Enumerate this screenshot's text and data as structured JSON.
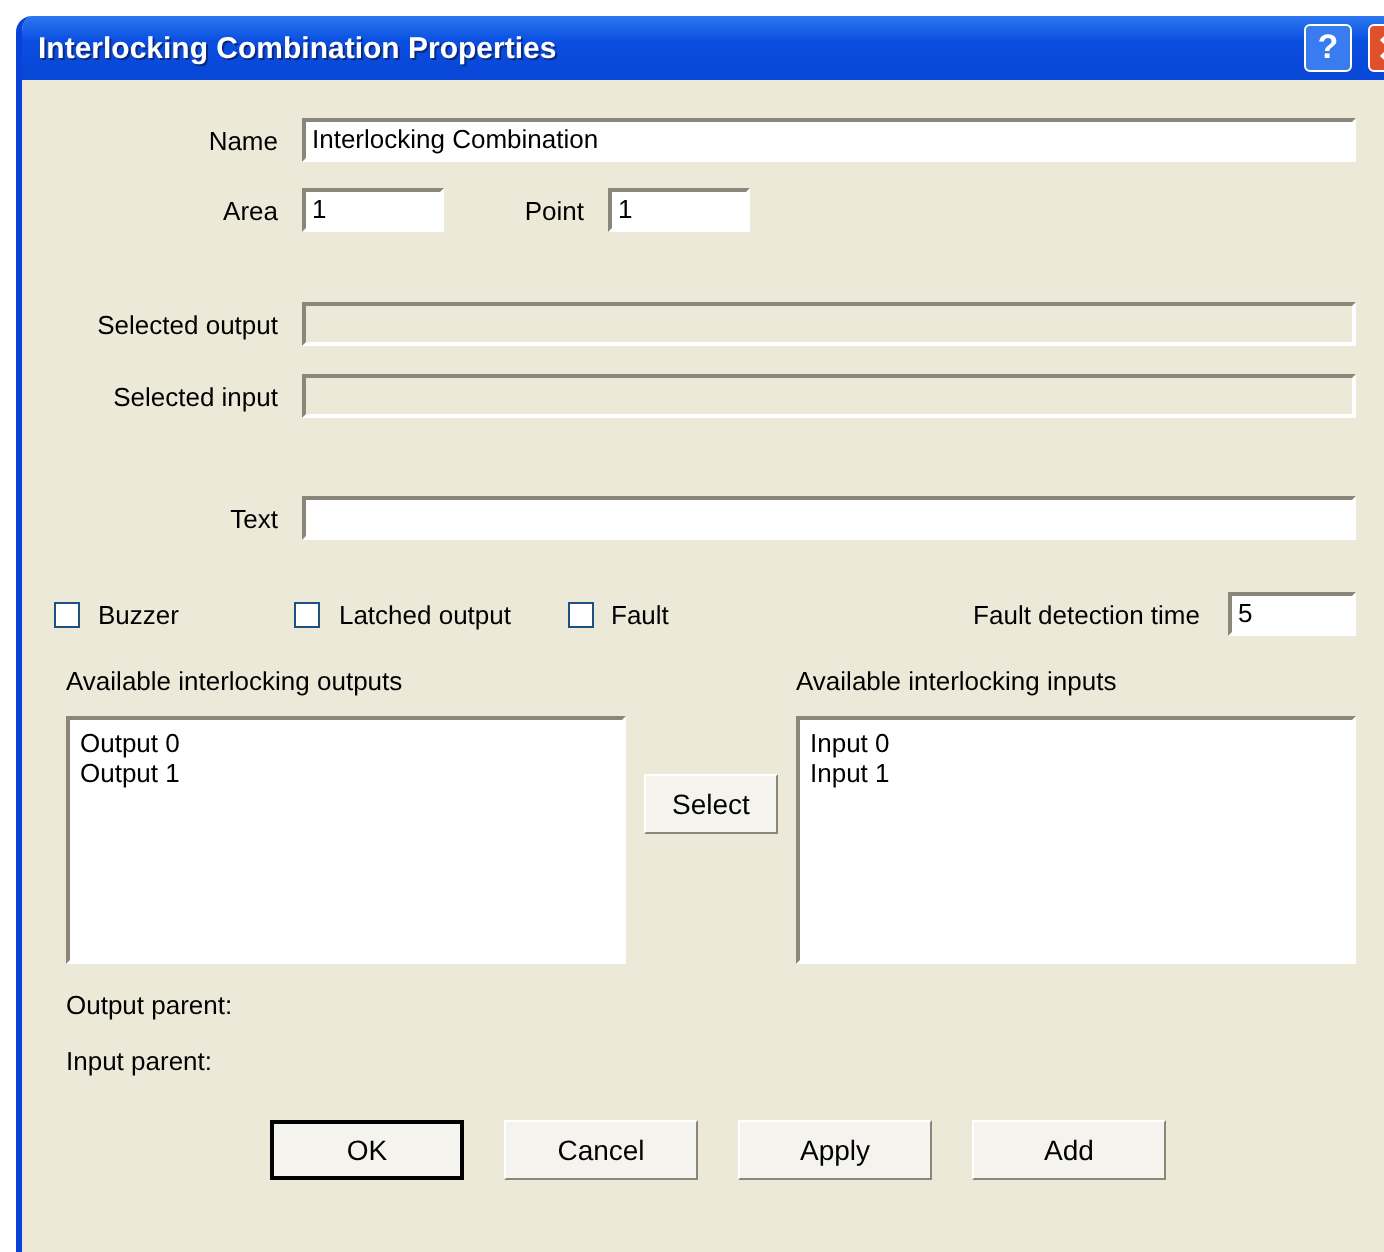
{
  "window": {
    "title": "Interlocking Combination Properties",
    "help_glyph": "?"
  },
  "name": {
    "label": "Name",
    "value": "Interlocking Combination"
  },
  "area": {
    "label": "Area",
    "value": "1"
  },
  "point": {
    "label": "Point",
    "value": "1"
  },
  "selected_output": {
    "label": "Selected output",
    "disabled": true
  },
  "selected_input": {
    "label": "Selected input",
    "disabled": true
  },
  "text": {
    "label": "Text",
    "disabled": false
  },
  "checkboxes": [
    {
      "label": "Buzzer",
      "checked": false
    },
    {
      "label": "Latched output",
      "checked": false
    },
    {
      "label": "Fault",
      "checked": false
    }
  ],
  "fault_detection_time": {
    "label": "Fault detection time",
    "value": "5"
  },
  "outputs": {
    "label": "Available interlocking outputs",
    "items": [
      "Output 0",
      "Output 1"
    ]
  },
  "inputs": {
    "label": "Available interlocking inputs",
    "items": [
      "Input 0",
      "Input 1"
    ]
  },
  "select_button": "Select",
  "output_parent": "Output parent:",
  "input_parent": "Input parent:",
  "buttons": [
    {
      "label": "OK",
      "default": true
    },
    {
      "label": "Cancel",
      "default": false
    },
    {
      "label": "Apply",
      "default": false
    },
    {
      "label": "Add",
      "default": false
    }
  ]
}
